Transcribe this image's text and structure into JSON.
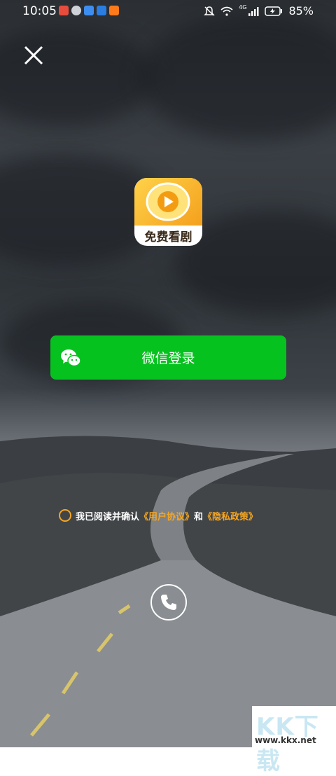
{
  "status_bar": {
    "time": "10:05",
    "battery": "85%",
    "network": "4G"
  },
  "brand": {
    "logo_text": "免费看剧"
  },
  "login": {
    "wechat_label": "微信登录"
  },
  "agreement": {
    "prefix": "我已阅读并确认",
    "user_agreement": "《用户协议》",
    "conjunction": "和",
    "privacy_policy": "《隐私政策》"
  },
  "watermark": {
    "big": "KK下载",
    "small": "www.kkx.net"
  },
  "colors": {
    "wechat_green": "#06c21f",
    "accent_orange": "#f5a623"
  }
}
